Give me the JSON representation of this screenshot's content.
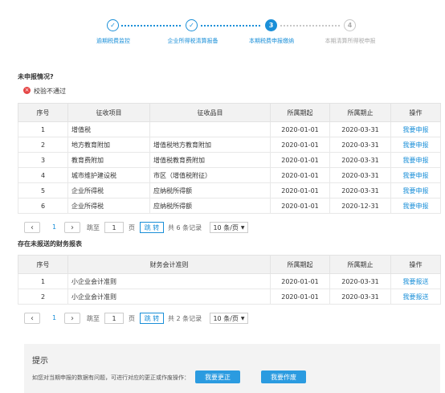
{
  "steps": [
    {
      "num": "✓",
      "label": "逾期税费监控",
      "state": "done"
    },
    {
      "num": "✓",
      "label": "企业所得税清算报备",
      "state": "done"
    },
    {
      "num": "3",
      "label": "本期税费申报缴纳",
      "state": "active"
    },
    {
      "num": "4",
      "label": "本期清算所得税申报",
      "state": "todo"
    }
  ],
  "section1": {
    "title": "未申报情况?",
    "status_text": "校验不通过",
    "headers": [
      "序号",
      "征收项目",
      "征收品目",
      "所属期起",
      "所属期止",
      "操作"
    ],
    "rows": [
      [
        "1",
        "增值税",
        "",
        "2020-01-01",
        "2020-03-31",
        "我要申报"
      ],
      [
        "2",
        "地方教育附加",
        "增值税地方教育附加",
        "2020-01-01",
        "2020-03-31",
        "我要申报"
      ],
      [
        "3",
        "教育费附加",
        "增值税教育费附加",
        "2020-01-01",
        "2020-03-31",
        "我要申报"
      ],
      [
        "4",
        "城市维护建设税",
        "市区（增值税附征）",
        "2020-01-01",
        "2020-03-31",
        "我要申报"
      ],
      [
        "5",
        "企业所得税",
        "应纳税所得额",
        "2020-01-01",
        "2020-03-31",
        "我要申报"
      ],
      [
        "6",
        "企业所得税",
        "应纳税所得额",
        "2020-01-01",
        "2020-12-31",
        "我要申报"
      ]
    ],
    "pager": {
      "prev": "‹",
      "current": "1",
      "next": "›",
      "goto_label": "跳至",
      "goto_value": "1",
      "page_unit": "页",
      "go_button": "跳 转",
      "total": "共 6 条记录",
      "page_size": "10 条/页"
    }
  },
  "section2": {
    "title": "存在未报送的财务报表",
    "headers": [
      "序号",
      "财务会计准则",
      "所属期起",
      "所属期止",
      "操作"
    ],
    "rows": [
      [
        "1",
        "小企业会计准则",
        "2020-01-01",
        "2020-03-31",
        "我要报送"
      ],
      [
        "2",
        "小企业会计准则",
        "2020-01-01",
        "2020-03-31",
        "我要报送"
      ]
    ],
    "pager": {
      "prev": "‹",
      "current": "1",
      "next": "›",
      "goto_label": "跳至",
      "goto_value": "1",
      "page_unit": "页",
      "go_button": "跳 转",
      "total": "共 2 条记录",
      "page_size": "10 条/页"
    }
  },
  "tip": {
    "title": "提示",
    "text": "如您对当期申报的数据有问题，可进行对应的更正或作废操作：",
    "correct_button": "我要更正",
    "void_button": "我要作废"
  },
  "colors": {
    "accent": "#1a8fd8",
    "error": "#e54545",
    "header_bg": "#f2f2f2"
  }
}
